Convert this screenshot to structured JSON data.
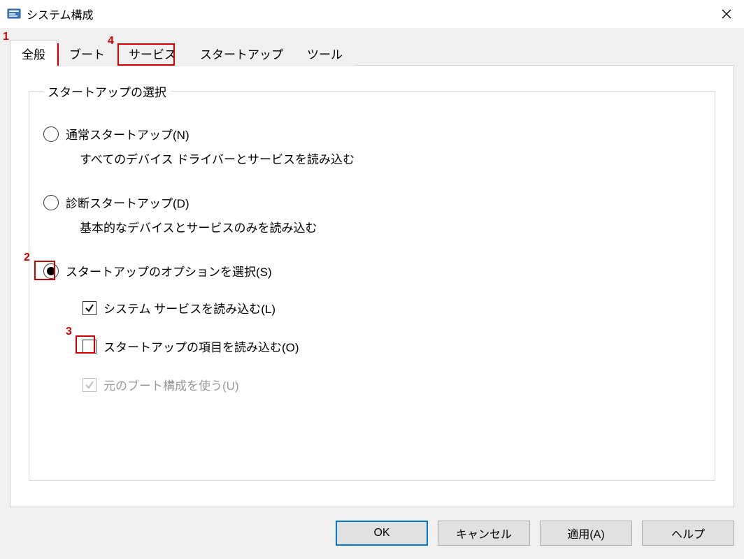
{
  "window": {
    "title": "システム構成"
  },
  "tabs": {
    "general": "全般",
    "boot": "ブート",
    "services": "サービス",
    "startup": "スタートアップ",
    "tools": "ツール"
  },
  "group": {
    "legend": "スタートアップの選択"
  },
  "options": {
    "normal": {
      "label": "通常スタートアップ(N)",
      "desc": "すべてのデバイス ドライバーとサービスを読み込む"
    },
    "diag": {
      "label": "診断スタートアップ(D)",
      "desc": "基本的なデバイスとサービスのみを読み込む"
    },
    "select": {
      "label": "スタートアップのオプションを選択(S)"
    }
  },
  "sub": {
    "services": "システム サービスを読み込む(L)",
    "startup": "スタートアップの項目を読み込む(O)",
    "origboot": "元のブート構成を使う(U)"
  },
  "buttons": {
    "ok": "OK",
    "cancel": "キャンセル",
    "apply": "適用(A)",
    "help": "ヘルプ"
  },
  "annotations": {
    "a1": "1",
    "a2": "2",
    "a3": "3",
    "a4": "4"
  }
}
